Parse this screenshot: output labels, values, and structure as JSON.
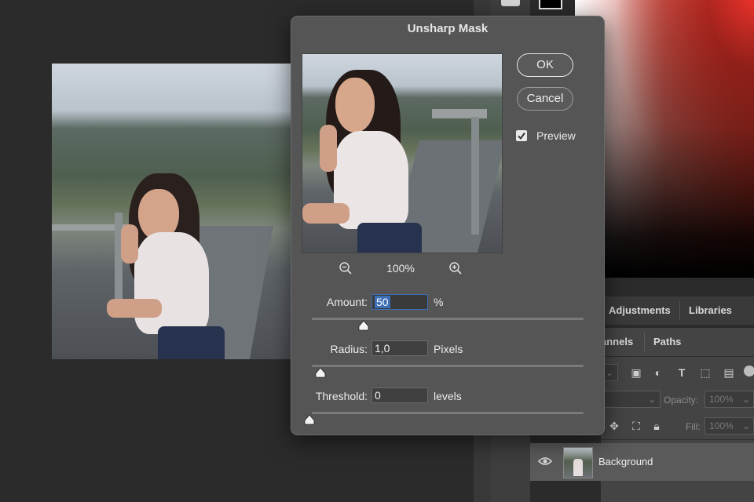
{
  "dialog": {
    "title": "Unsharp Mask",
    "ok_label": "OK",
    "cancel_label": "Cancel",
    "preview_label": "Preview",
    "preview_checked": true,
    "zoom_level": "100%",
    "amount": {
      "label": "Amount:",
      "value": "50",
      "unit": "%",
      "slider_fraction": 0.2
    },
    "radius": {
      "label": "Radius:",
      "value": "1,0",
      "unit": "Pixels",
      "slider_fraction": 0.04
    },
    "threshold": {
      "label": "Threshold:",
      "value": "0",
      "unit": "levels",
      "slider_fraction": 0.0
    }
  },
  "panels": {
    "tabs_top": [
      "Adjustments",
      "Libraries"
    ],
    "tabs_layers": [
      "annels",
      "Paths"
    ],
    "opacity_label": "Opacity:",
    "opacity_value": "100%",
    "fill_label": "Fill:",
    "fill_value": "100%",
    "layer_name": "Background"
  },
  "colors": {
    "accent_selection": "#3d6fb6",
    "dialog_bg": "#555555",
    "panel_bg": "#424242",
    "canvas_bg": "#2b2b2b"
  }
}
